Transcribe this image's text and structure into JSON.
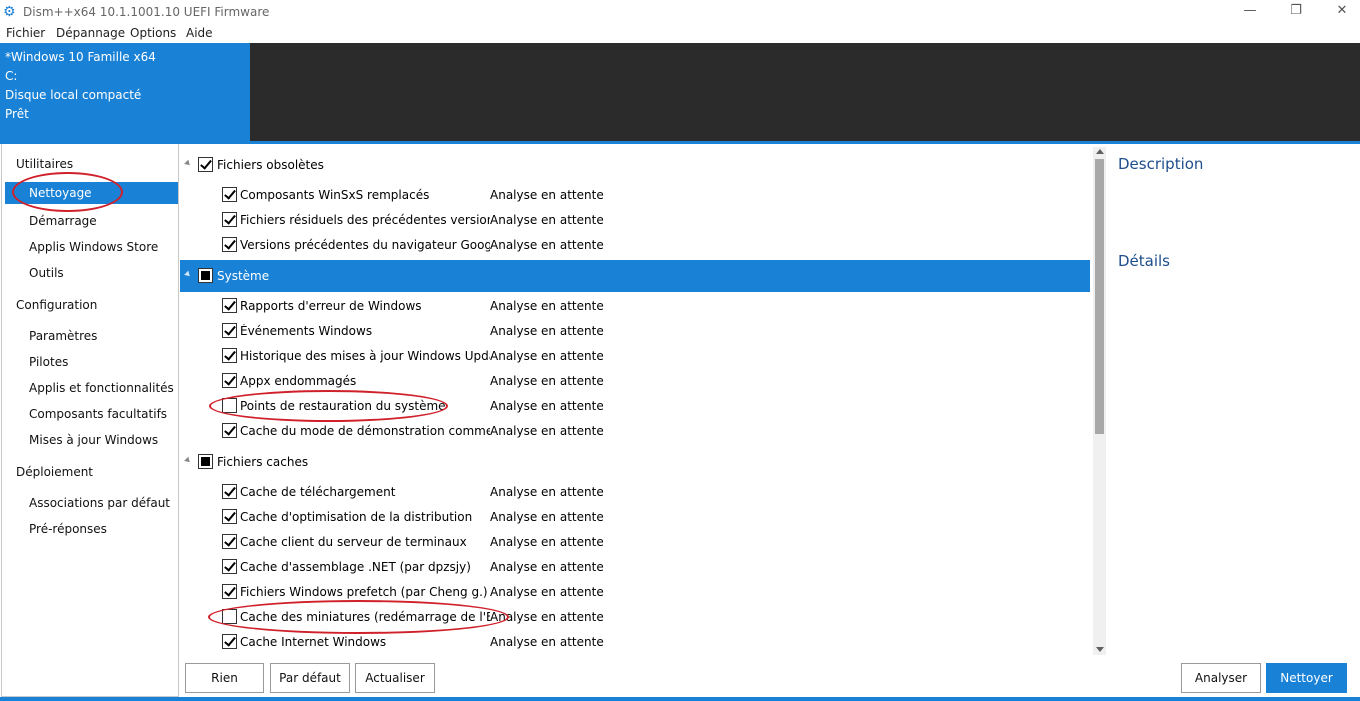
{
  "window": {
    "title": "Dism++x64 10.1.1001.10 UEFI Firmware",
    "minimize_glyph": "—",
    "maximize_glyph": "❐",
    "close_glyph": "✕"
  },
  "menu": [
    "Fichier",
    "Dépannage",
    "Options",
    "Aide"
  ],
  "header": {
    "lines": [
      "*Windows 10 Famille x64",
      "C:",
      "Disque local compacté",
      "Prêt"
    ]
  },
  "sidebar": {
    "groups": [
      {
        "label": "Utilitaires",
        "items": [
          "Nettoyage",
          "Démarrage",
          "Applis Windows Store",
          "Outils"
        ]
      },
      {
        "label": "Configuration",
        "items": [
          "Paramètres",
          "Pilotes",
          "Applis et fonctionnalités",
          "Composants facultatifs",
          "Mises à jour Windows"
        ]
      },
      {
        "label": "Déploiement",
        "items": [
          "Associations par défaut",
          "Pré-réponses"
        ]
      }
    ],
    "selected": "Nettoyage"
  },
  "list": {
    "groups": [
      {
        "label": "Fichiers obsolètes",
        "state": "checked",
        "items": [
          {
            "label": "Composants WinSxS remplacés",
            "status": "Analyse en attente",
            "checked": true
          },
          {
            "label": "Fichiers résiduels des précédentes versions de D",
            "status": "Analyse en attente",
            "checked": true
          },
          {
            "label": "Versions précédentes du navigateur Google Chr",
            "status": "Analyse en attente",
            "checked": true
          }
        ]
      },
      {
        "label": "Système",
        "state": "partial",
        "selected": true,
        "items": [
          {
            "label": "Rapports d'erreur de Windows",
            "status": "Analyse en attente",
            "checked": true
          },
          {
            "label": "Événements Windows",
            "status": "Analyse en attente",
            "checked": true
          },
          {
            "label": "Historique des mises à jour Windows Update",
            "status": "Analyse en attente",
            "checked": true
          },
          {
            "label": "Appx endommagés",
            "status": "Analyse en attente",
            "checked": true
          },
          {
            "label": "Points de restauration du système",
            "status": "Analyse en attente",
            "checked": false
          },
          {
            "label": "Cache du mode de démonstration commerciale",
            "status": "Analyse en attente",
            "checked": true
          }
        ]
      },
      {
        "label": "Fichiers caches",
        "state": "partial",
        "items": [
          {
            "label": "Cache de téléchargement",
            "status": "Analyse en attente",
            "checked": true
          },
          {
            "label": "Cache d'optimisation de la distribution",
            "status": "Analyse en attente",
            "checked": true
          },
          {
            "label": "Cache client du serveur de terminaux",
            "status": "Analyse en attente",
            "checked": true
          },
          {
            "label": "Cache d'assemblage .NET (par dpzsjy)",
            "status": "Analyse en attente",
            "checked": true
          },
          {
            "label": "Fichiers Windows prefetch (par Cheng g.)",
            "status": "Analyse en attente",
            "checked": true
          },
          {
            "label": "Cache des miniatures (redémarrage de l'Explora",
            "status": "Analyse en attente",
            "checked": false
          },
          {
            "label": "Cache Internet Windows",
            "status": "Analyse en attente",
            "checked": true
          }
        ]
      }
    ]
  },
  "right_panel": {
    "description_title": "Description",
    "details_title": "Détails"
  },
  "buttons": {
    "rien": "Rien",
    "par_defaut": "Par défaut",
    "actualiser": "Actualiser",
    "analyser": "Analyser",
    "nettoyer": "Nettoyer"
  },
  "colors": {
    "accent": "#1a82d6",
    "header_dark": "#2b2b2b",
    "annotation": "#d0202a"
  }
}
